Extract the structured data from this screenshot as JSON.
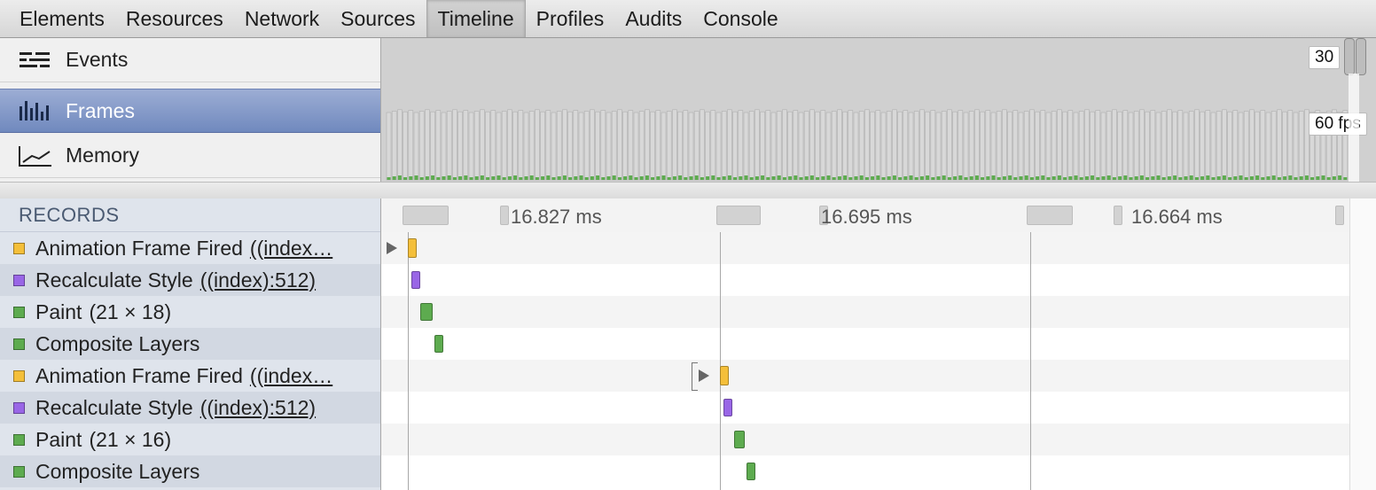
{
  "toolbar": {
    "tabs": [
      {
        "label": "Elements"
      },
      {
        "label": "Resources"
      },
      {
        "label": "Network"
      },
      {
        "label": "Sources"
      },
      {
        "label": "Timeline",
        "active": true
      },
      {
        "label": "Profiles"
      },
      {
        "label": "Audits"
      },
      {
        "label": "Console"
      }
    ]
  },
  "overview": {
    "items": [
      {
        "label": "Events",
        "icon": "events-icon"
      },
      {
        "label": "Frames",
        "icon": "frames-icon",
        "selected": true
      },
      {
        "label": "Memory",
        "icon": "memory-icon"
      }
    ],
    "fps_top": "30",
    "fps_bottom": "60 fps"
  },
  "records": {
    "header": "RECORDS",
    "frame_durations": [
      "16.827 ms",
      "16.695 ms",
      "16.664 ms"
    ],
    "rows": [
      {
        "name": "Animation Frame Fired",
        "detail": "((index…",
        "type": "script",
        "color": "#f4bf3a"
      },
      {
        "name": "Recalculate Style",
        "detail": "((index):512)",
        "type": "rendering",
        "color": "#9966e6"
      },
      {
        "name": "Paint",
        "detail": "(21 × 18)",
        "type": "painting",
        "color": "#5dab4f",
        "plain_detail": true
      },
      {
        "name": "Composite Layers",
        "detail": "",
        "type": "painting",
        "color": "#5dab4f"
      },
      {
        "name": "Animation Frame Fired",
        "detail": "((index…",
        "type": "script",
        "color": "#f4bf3a"
      },
      {
        "name": "Recalculate Style",
        "detail": "((index):512)",
        "type": "rendering",
        "color": "#9966e6"
      },
      {
        "name": "Paint",
        "detail": "(21 × 16)",
        "type": "painting",
        "color": "#5dab4f",
        "plain_detail": true
      },
      {
        "name": "Composite Layers",
        "detail": "",
        "type": "painting",
        "color": "#5dab4f"
      }
    ]
  },
  "colors": {
    "script": "#f4bf3a",
    "rendering": "#9966e6",
    "painting": "#5dab4f",
    "selected_nav": "#7a92c6"
  }
}
